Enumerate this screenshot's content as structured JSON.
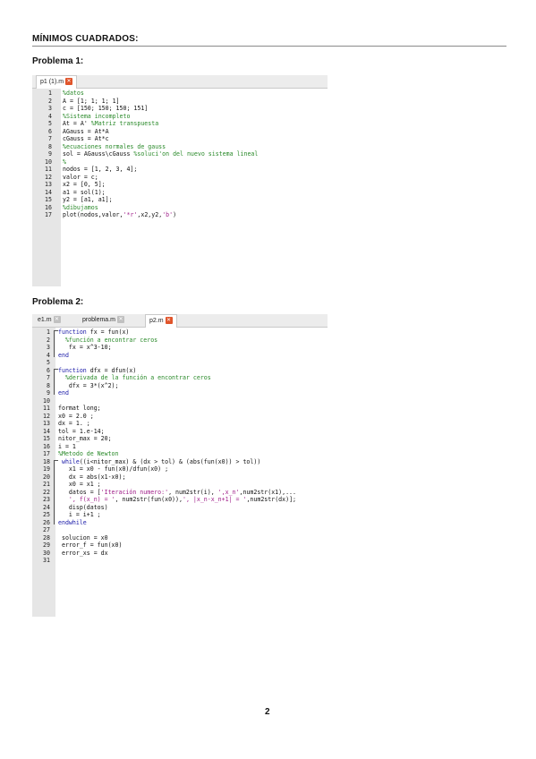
{
  "page": {
    "heading": "MÍNIMOS CUADRADOS:",
    "page_number": "2"
  },
  "problem1": {
    "title": "Problema 1:",
    "tabs": [
      {
        "label": "p1 (1).m",
        "active": true
      }
    ],
    "lines": [
      [
        {
          "t": "%datos",
          "c": "cm"
        }
      ],
      [
        {
          "t": "A = [1; 1; 1; 1]"
        }
      ],
      [
        {
          "t": "c = [150; 150; 150; 151]"
        }
      ],
      [
        {
          "t": "%Sistema incompleto",
          "c": "cm"
        }
      ],
      [
        {
          "t": "At = A' "
        },
        {
          "t": "%Matriz transpuesta",
          "c": "cm"
        }
      ],
      [
        {
          "t": "AGauss = At*A"
        }
      ],
      [
        {
          "t": "cGauss = At*c"
        }
      ],
      [
        {
          "t": "%ecuaciones normales de gauss",
          "c": "cm"
        }
      ],
      [
        {
          "t": "sol = AGauss\\cGauss "
        },
        {
          "t": "%soluci'on del nuevo sistema lineal",
          "c": "cm"
        }
      ],
      [
        {
          "t": "%",
          "c": "cm"
        }
      ],
      [
        {
          "t": "nodos = [1, 2, 3, 4];"
        }
      ],
      [
        {
          "t": "valor = c;"
        }
      ],
      [
        {
          "t": "x2 = [0, 5];"
        }
      ],
      [
        {
          "t": "a1 = sol(1);"
        }
      ],
      [
        {
          "t": "y2 = [a1, a1];"
        }
      ],
      [
        {
          "t": "%dibujamos",
          "c": "cm"
        }
      ],
      [
        {
          "t": "plot(nodos,valor,"
        },
        {
          "t": "'*r'",
          "c": "st"
        },
        {
          "t": ",x2,y2,"
        },
        {
          "t": "'b'",
          "c": "st"
        },
        {
          "t": ")"
        }
      ]
    ]
  },
  "problem2": {
    "title": "Problema 2:",
    "tabs": [
      {
        "label": "e1.m",
        "active": false
      },
      {
        "label": "problema.m",
        "active": false
      },
      {
        "label": "p2.m",
        "active": true
      }
    ],
    "lines": [
      [
        {
          "t": "function",
          "c": "kw"
        },
        {
          "t": " fx = fun(x)"
        }
      ],
      [
        {
          "t": "  %función a encontrar ceros",
          "c": "cm"
        }
      ],
      [
        {
          "t": "   fx = x^3-10;"
        }
      ],
      [
        {
          "t": "end",
          "c": "kw"
        }
      ],
      [],
      [
        {
          "t": "function",
          "c": "kw"
        },
        {
          "t": " dfx = dfun(x)"
        }
      ],
      [
        {
          "t": "  %derivada de la función a encontrar ceros",
          "c": "cm"
        }
      ],
      [
        {
          "t": "   dfx = 3*(x^2);"
        }
      ],
      [
        {
          "t": "end",
          "c": "kw"
        }
      ],
      [],
      [
        {
          "t": "format long;"
        }
      ],
      [
        {
          "t": "x0 = 2.0 ;"
        }
      ],
      [
        {
          "t": "dx = 1. ;"
        }
      ],
      [
        {
          "t": "tol = 1.e-14;"
        }
      ],
      [
        {
          "t": "nitor_max = 20;"
        }
      ],
      [
        {
          "t": "i = 1"
        }
      ],
      [
        {
          "t": "%Metodo de Newton",
          "c": "cm"
        }
      ],
      [
        {
          "t": " while",
          "c": "kw"
        },
        {
          "t": "((i<nitor_max) & (dx > tol) & (abs(fun(x0)) > tol))"
        }
      ],
      [
        {
          "t": "   x1 = x0 - fun(x0)/dfun(x0) ;"
        }
      ],
      [
        {
          "t": "   dx = abs(x1-x0);"
        }
      ],
      [
        {
          "t": "   x0 = x1 ;"
        }
      ],
      [
        {
          "t": "   datos = ["
        },
        {
          "t": "'Iteración numero:'",
          "c": "st"
        },
        {
          "t": ", num2str(i), "
        },
        {
          "t": "',x_n'",
          "c": "st"
        },
        {
          "t": ",num2str(x1),..."
        }
      ],
      [
        {
          "t": "   "
        },
        {
          "t": "', f(x_n) = '",
          "c": "st"
        },
        {
          "t": ", num2str(fun(x0)),"
        },
        {
          "t": "', |x_n-x_n+1| = '",
          "c": "st"
        },
        {
          "t": ",num2str(dx)];"
        }
      ],
      [
        {
          "t": "   disp(datos)"
        }
      ],
      [
        {
          "t": "   i = i+1 ;"
        }
      ],
      [
        {
          "t": "endwhile",
          "c": "kw"
        }
      ],
      [],
      [
        {
          "t": " solucion = x0"
        }
      ],
      [
        {
          "t": " error_f = fun(x0)"
        }
      ],
      [
        {
          "t": " error_xs = dx"
        }
      ],
      []
    ]
  }
}
